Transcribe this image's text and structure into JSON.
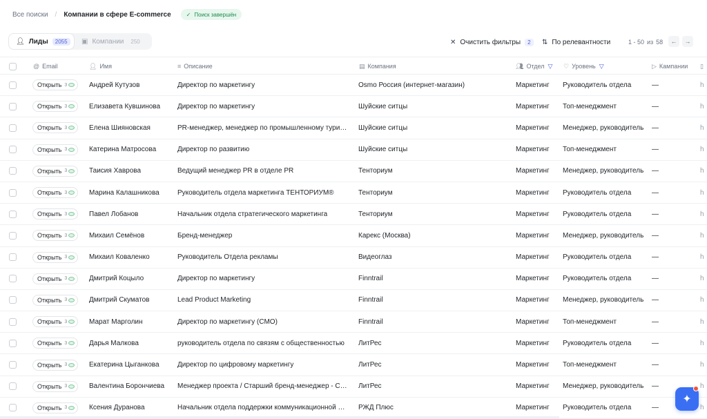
{
  "breadcrumb": {
    "root": "Все поиски",
    "separator": "/",
    "current": "Компании в сфере E-commerce"
  },
  "status": {
    "label": "Поиск завершён",
    "color": "#1f8a4c"
  },
  "tabs": [
    {
      "label": "Лиды",
      "count": "2055",
      "icon": "user-icon",
      "active": true
    },
    {
      "label": "Компании",
      "count": "250",
      "icon": "building-icon",
      "active": false
    }
  ],
  "toolbar": {
    "clear_filters": "Очистить фильтры",
    "filter_count": "2",
    "sort": "По релевантности"
  },
  "pagination": {
    "range": "1 - 50",
    "of_label": "из",
    "total": "58"
  },
  "columns": {
    "email": "Email",
    "name": "Имя",
    "description": "Описание",
    "company": "Компания",
    "department": "Отдел",
    "level": "Уровень",
    "campaigns": "Кампании"
  },
  "open_label": "Открыть",
  "rows": [
    {
      "n": "3",
      "name": "Андрей Кутузов",
      "desc": "Директор по маркетингу",
      "company": "Osmo Россия (интернет-магазин)",
      "dept": "Маркетинг",
      "level": "Руководитель отдела",
      "camp": "—",
      "extra": "h"
    },
    {
      "n": "3",
      "name": "Елизавета Кувшинова",
      "desc": "Директор по маркетингу",
      "company": "Шуйские ситцы",
      "dept": "Маркетинг",
      "level": "Топ-менеджмент",
      "camp": "—",
      "extra": "h"
    },
    {
      "n": "3",
      "name": "Елена Шияновская",
      "desc": "PR-менеджер, менеджер по промышленному туризму",
      "company": "Шуйские ситцы",
      "dept": "Маркетинг",
      "level": "Менеджер, руководитель",
      "camp": "—",
      "extra": "h"
    },
    {
      "n": "3",
      "name": "Катерина Матросова",
      "desc": "Директор по развитию",
      "company": "Шуйские ситцы",
      "dept": "Маркетинг",
      "level": "Топ-менеджмент",
      "camp": "—",
      "extra": "h"
    },
    {
      "n": "3",
      "name": "Таисия Хаврова",
      "desc": "Ведущий менеджер PR в отделе PR",
      "company": "Тенториум",
      "dept": "Маркетинг",
      "level": "Менеджер, руководитель",
      "camp": "—",
      "extra": "h"
    },
    {
      "n": "3",
      "name": "Марина Калашникова",
      "desc": "Руководитель отдела маркетинга ТЕНТОРИУМ®",
      "company": "Тенториум",
      "dept": "Маркетинг",
      "level": "Руководитель отдела",
      "camp": "—",
      "extra": "h"
    },
    {
      "n": "3",
      "name": "Павел Лобанов",
      "desc": "Начальник отдела стратегического маркетинга",
      "company": "Тенториум",
      "dept": "Маркетинг",
      "level": "Руководитель отдела",
      "camp": "—",
      "extra": "h"
    },
    {
      "n": "3",
      "name": "Михаил Семёнов",
      "desc": "Бренд-менеджер",
      "company": "Карекс (Москва)",
      "dept": "Маркетинг",
      "level": "Менеджер, руководитель",
      "camp": "—",
      "extra": "h"
    },
    {
      "n": "3",
      "name": "Михаил Коваленко",
      "desc": "Руководитель Отдела рекламы",
      "company": "Видеоглаз",
      "dept": "Маркетинг",
      "level": "Руководитель отдела",
      "camp": "—",
      "extra": "h"
    },
    {
      "n": "3",
      "name": "Дмитрий Коцыло",
      "desc": "Директор по маркетингу",
      "company": "Finntrail",
      "dept": "Маркетинг",
      "level": "Руководитель отдела",
      "camp": "—",
      "extra": "h"
    },
    {
      "n": "3",
      "name": "Дмитрий Скуматов",
      "desc": "Lead Product Marketing",
      "company": "Finntrail",
      "dept": "Маркетинг",
      "level": "Менеджер, руководитель",
      "camp": "—",
      "extra": "h"
    },
    {
      "n": "3",
      "name": "Марат Марголин",
      "desc": "Директор по маркетингу (CMO)",
      "company": "Finntrail",
      "dept": "Маркетинг",
      "level": "Топ-менеджмент",
      "camp": "—",
      "extra": "h"
    },
    {
      "n": "3",
      "name": "Дарья Малкова",
      "desc": "руководитель отдела по связям с общественностью",
      "company": "ЛитРес",
      "dept": "Маркетинг",
      "level": "Руководитель отдела",
      "camp": "—",
      "extra": "h"
    },
    {
      "n": "3",
      "name": "Екатерина Цыганкова",
      "desc": "Директор по цифровому маркетингу",
      "company": "ЛитРес",
      "dept": "Маркетинг",
      "level": "Топ-менеджмент",
      "camp": "—",
      "extra": "h"
    },
    {
      "n": "3",
      "name": "Валентина Борончиева",
      "desc": "Менеджер проекта / Старший бренд-менеджер - Слу…",
      "company": "ЛитРес",
      "dept": "Маркетинг",
      "level": "Менеджер, руководитель",
      "camp": "—",
      "extra": "h"
    },
    {
      "n": "3",
      "name": "Ксения Дуранова",
      "desc": "Начальник отдела поддержки коммуникационной дея…",
      "company": "РЖД Плюс",
      "dept": "Маркетинг",
      "level": "Руководитель отдела",
      "camp": "—",
      "extra": "h"
    }
  ],
  "colors": {
    "accent": "#4b5bd6",
    "fab": "#3b6ff3",
    "notification": "#f0533e"
  }
}
